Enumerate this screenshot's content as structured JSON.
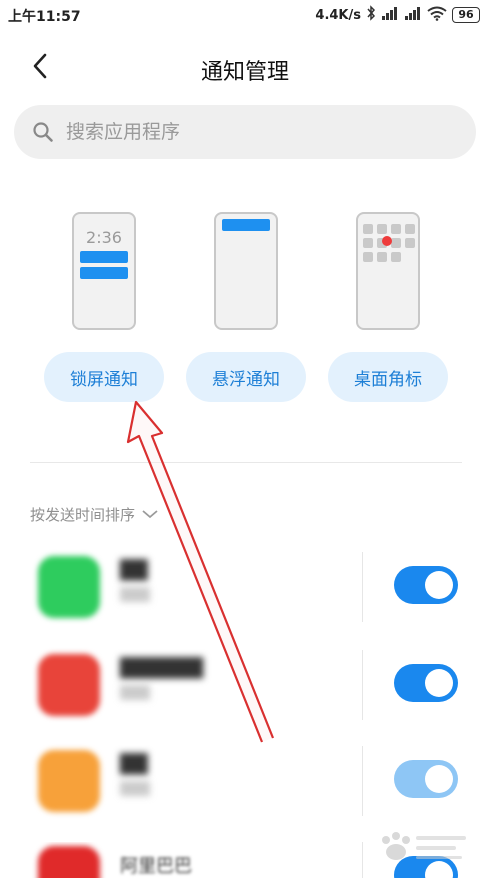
{
  "status_bar": {
    "time": "上午11:57",
    "speed": "4.4K/s",
    "battery": "96",
    "icons": [
      "bluetooth-icon",
      "signal-icon",
      "signal-icon",
      "wifi-icon",
      "battery-icon"
    ]
  },
  "header": {
    "title": "通知管理",
    "back_icon": "chevron-left-icon"
  },
  "search": {
    "placeholder": "搜索应用程序",
    "icon": "search-icon"
  },
  "notification_types": {
    "preview_time": "2:36",
    "items": [
      {
        "label": "锁屏通知"
      },
      {
        "label": "悬浮通知"
      },
      {
        "label": "桌面角标"
      }
    ]
  },
  "sort": {
    "label": "按发送时间排序",
    "icon": "chevron-down-icon"
  },
  "apps": [
    {
      "icon_color": "#2ecc5e",
      "enabled": true
    },
    {
      "icon_color": "#e8443a",
      "enabled": true
    },
    {
      "icon_color": "#f7a13a",
      "enabled": true
    },
    {
      "name": "阿里巴巴",
      "icon_color": "#e02a2a",
      "enabled": true
    }
  ],
  "colors": {
    "accent": "#1a88ee",
    "button_bg": "#e3f1fd",
    "annotation": "#d93030"
  }
}
